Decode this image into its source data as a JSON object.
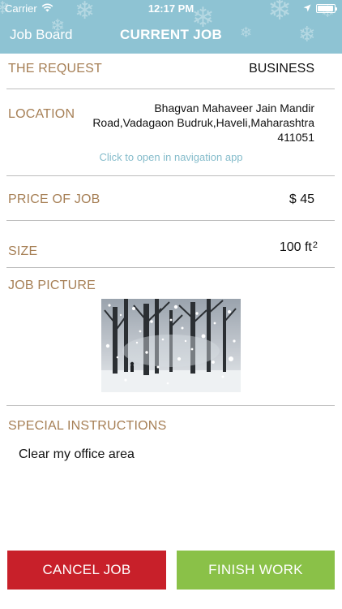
{
  "status_bar": {
    "carrier": "Carrier",
    "time": "12:17 PM"
  },
  "nav": {
    "back_label": "Job Board",
    "title": "CURRENT JOB"
  },
  "job": {
    "request_label": "THE REQUEST",
    "request_value": "BUSINESS",
    "location_label": "LOCATION",
    "address": "Bhagvan Mahaveer Jain Mandir Road,Vadagaon Budruk,Haveli,Maharashtra 411051",
    "navigation_link": "Click to open in navigation app",
    "price_label": "PRICE OF JOB",
    "price_value": "$ 45",
    "size_label": "SIZE",
    "size_value": "100 ft",
    "size_unit_power": "2",
    "picture_label": "JOB PICTURE",
    "special_label": "SPECIAL INSTRUCTIONS",
    "special_text": "Clear my office area"
  },
  "actions": {
    "cancel_label": "CANCEL JOB",
    "finish_label": "FINISH WORK"
  },
  "colors": {
    "header": "#8ec3d3",
    "label": "#a67f55",
    "link": "#85bccb",
    "cancel": "#c8202a",
    "finish": "#8ac148"
  }
}
